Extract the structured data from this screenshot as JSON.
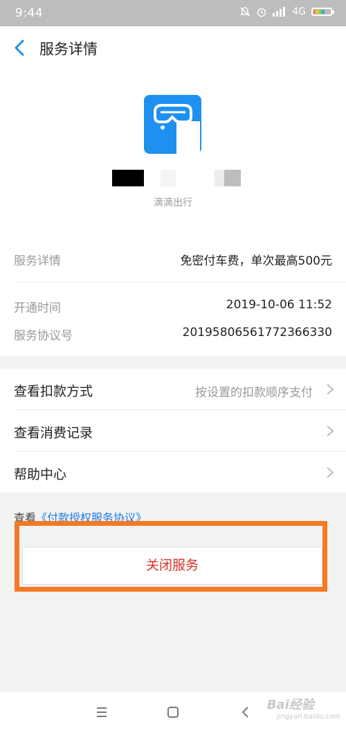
{
  "status": {
    "time": "9:44",
    "network": "4G"
  },
  "nav": {
    "title": "服务详情"
  },
  "app": {
    "name": "滴滴出行"
  },
  "details": [
    {
      "label": "服务详情",
      "value": "免密付车费，单次最高500元"
    },
    {
      "label": "开通时间",
      "value": "2019-10-06 11:52"
    },
    {
      "label": "服务协议号",
      "value": "20195806561772366330"
    }
  ],
  "menu": [
    {
      "label": "查看扣款方式",
      "value": "按设置的扣款顺序支付"
    },
    {
      "label": "查看消费记录",
      "value": ""
    },
    {
      "label": "帮助中心",
      "value": ""
    }
  ],
  "agreement": {
    "prefix": "查看",
    "link": "《付款授权服务协议》"
  },
  "close_button": "关闭服务",
  "watermark": {
    "brand": "Bai经验",
    "url": "jingyan.baidu.com"
  },
  "colors": {
    "accent": "#1e90ef",
    "danger": "#d8302a",
    "highlight": "#f47a24"
  }
}
